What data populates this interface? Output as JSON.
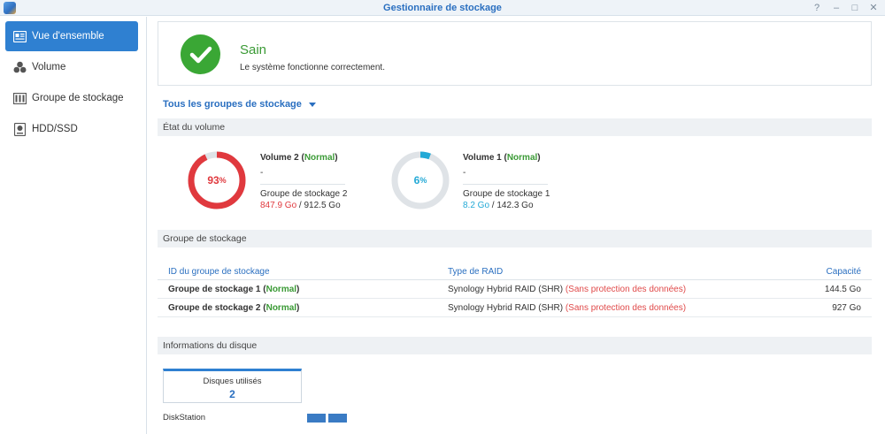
{
  "window": {
    "title": "Gestionnaire de stockage",
    "help": "?",
    "minimize": "–",
    "maximize": "□",
    "close": "✕"
  },
  "sidebar": {
    "items": [
      {
        "label": "Vue d'ensemble",
        "icon": "overview-icon"
      },
      {
        "label": "Volume",
        "icon": "volume-icon"
      },
      {
        "label": "Groupe de stockage",
        "icon": "storage-pool-icon"
      },
      {
        "label": "HDD/SSD",
        "icon": "hdd-icon"
      }
    ]
  },
  "health": {
    "status": "Sain",
    "description": "Le système fonctionne correctement.",
    "color": "#3aa735"
  },
  "group_selector": {
    "label": "Tous les groupes de stockage"
  },
  "volume_section": {
    "header": "État du volume",
    "volumes": [
      {
        "name": "Volume 2",
        "status": "Normal",
        "dash": "-",
        "pool": "Groupe de stockage 2",
        "used": "847.9 Go",
        "total": "912.5 Go",
        "percent": 93,
        "percent_label": "93",
        "percent_unit": "%",
        "color": "#e0393e"
      },
      {
        "name": "Volume 1",
        "status": "Normal",
        "dash": "-",
        "pool": "Groupe de stockage 1",
        "used": "8.2 Go",
        "total": "142.3 Go",
        "percent": 6,
        "percent_label": "6",
        "percent_unit": "%",
        "color": "#23a9d6"
      }
    ]
  },
  "pool_section": {
    "header": "Groupe de stockage",
    "columns": [
      "ID du groupe de stockage",
      "Type de RAID",
      "Capacité"
    ],
    "rows": [
      {
        "name": "Groupe de stockage 1",
        "status": "Normal",
        "raid": "Synology Hybrid RAID (SHR)",
        "raid_note": "(Sans protection des données)",
        "capacity": "144.5 Go"
      },
      {
        "name": "Groupe de stockage 2",
        "status": "Normal",
        "raid": "Synology Hybrid RAID (SHR)",
        "raid_note": "(Sans protection des données)",
        "capacity": "927 Go"
      }
    ]
  },
  "disk_section": {
    "header": "Informations du disque",
    "used_label": "Disques utilisés",
    "used_count": "2",
    "device": "DiskStation"
  }
}
